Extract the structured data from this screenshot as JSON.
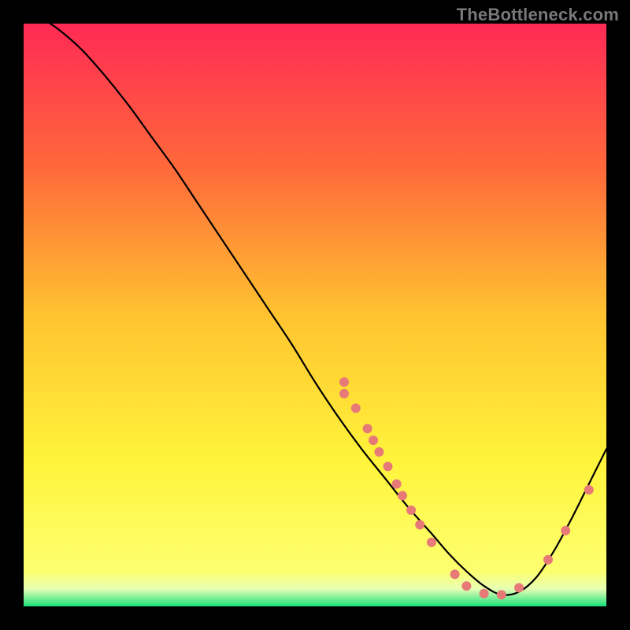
{
  "watermark": "TheBottleneck.com",
  "chart_data": {
    "type": "line",
    "title": "",
    "xlabel": "",
    "ylabel": "",
    "xlim": [
      0,
      100
    ],
    "ylim": [
      0,
      100
    ],
    "grid": false,
    "background_gradient": {
      "stops": [
        {
          "offset": 0.0,
          "color": "#ff2a55"
        },
        {
          "offset": 0.25,
          "color": "#ff6a3a"
        },
        {
          "offset": 0.5,
          "color": "#ffc330"
        },
        {
          "offset": 0.75,
          "color": "#fff43a"
        },
        {
          "offset": 0.94,
          "color": "#fdff70"
        },
        {
          "offset": 0.97,
          "color": "#e8ffb5"
        },
        {
          "offset": 1.0,
          "color": "#18e07a"
        }
      ]
    },
    "series": [
      {
        "name": "curve",
        "color": "#000000",
        "stroke_width": 2.2,
        "x": [
          0,
          3,
          6,
          10,
          14,
          18,
          22,
          26,
          30,
          34,
          38,
          42,
          46,
          50,
          54,
          58,
          62,
          66,
          70,
          73,
          76,
          79,
          82,
          85,
          88,
          91,
          94,
          97,
          100
        ],
        "y": [
          103,
          101,
          99,
          95.5,
          91,
          86,
          80.5,
          75,
          69,
          63,
          57,
          51,
          45,
          38.5,
          32.5,
          27,
          22,
          17,
          12.5,
          9,
          6,
          3.5,
          2,
          2.5,
          5,
          9.5,
          15,
          21,
          27
        ]
      }
    ],
    "scatter": {
      "name": "markers",
      "color": "#e77a77",
      "radius": 6,
      "points": [
        {
          "x": 55,
          "y": 38.5
        },
        {
          "x": 55,
          "y": 36.5
        },
        {
          "x": 57,
          "y": 34
        },
        {
          "x": 59,
          "y": 30.5
        },
        {
          "x": 60,
          "y": 28.5
        },
        {
          "x": 61,
          "y": 26.5
        },
        {
          "x": 62.5,
          "y": 24
        },
        {
          "x": 64,
          "y": 21
        },
        {
          "x": 65,
          "y": 19
        },
        {
          "x": 66.5,
          "y": 16.5
        },
        {
          "x": 68,
          "y": 14
        },
        {
          "x": 70,
          "y": 11
        },
        {
          "x": 74,
          "y": 5.5
        },
        {
          "x": 76,
          "y": 3.5
        },
        {
          "x": 79,
          "y": 2.2
        },
        {
          "x": 82,
          "y": 2
        },
        {
          "x": 85,
          "y": 3.2
        },
        {
          "x": 90,
          "y": 8
        },
        {
          "x": 93,
          "y": 13
        },
        {
          "x": 97,
          "y": 20
        }
      ]
    }
  }
}
